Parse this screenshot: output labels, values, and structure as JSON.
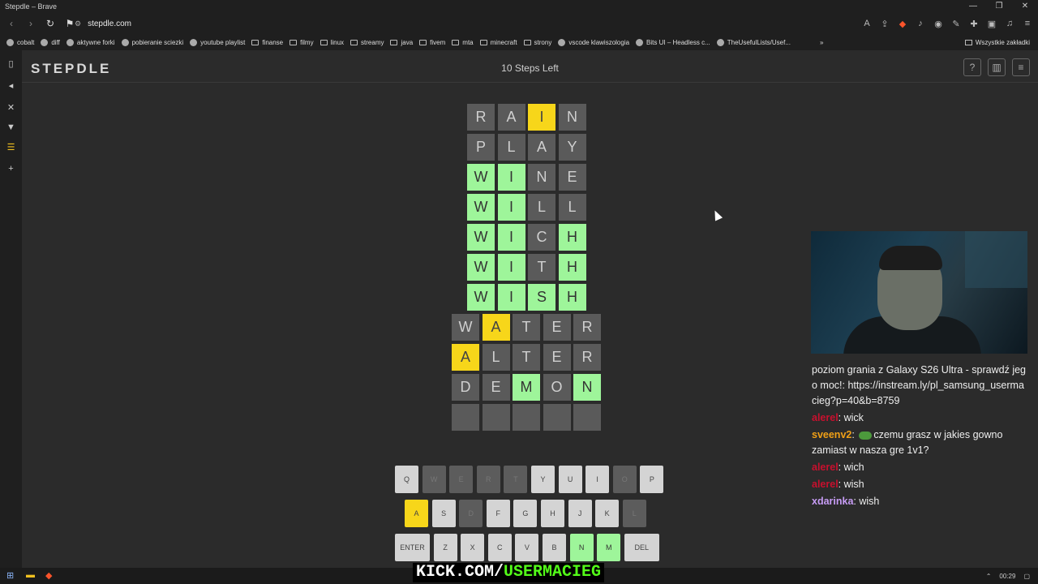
{
  "window": {
    "title": "Stepdle – Brave",
    "controls": [
      "—",
      "❐",
      "✕"
    ]
  },
  "browser": {
    "url": "stepdle.com",
    "bookmarks": [
      {
        "label": "cobalt",
        "icon": "cobalt-icon"
      },
      {
        "label": "diff",
        "icon": "diff-icon"
      },
      {
        "label": "aktywne forki",
        "icon": "fork-icon"
      },
      {
        "label": "pobieranie sciezki",
        "icon": "download-icon"
      },
      {
        "label": "youtube playlist",
        "icon": "globe-icon"
      },
      {
        "label": "finanse",
        "icon": "folder-icon"
      },
      {
        "label": "filmy",
        "icon": "folder-icon"
      },
      {
        "label": "linux",
        "icon": "folder-icon"
      },
      {
        "label": "streamy",
        "icon": "folder-icon"
      },
      {
        "label": "java",
        "icon": "folder-icon"
      },
      {
        "label": "fivem",
        "icon": "folder-icon"
      },
      {
        "label": "mta",
        "icon": "folder-icon"
      },
      {
        "label": "minecraft",
        "icon": "folder-icon"
      },
      {
        "label": "strony",
        "icon": "folder-icon"
      },
      {
        "label": "vscode klawiszologia",
        "icon": "vscode-icon"
      },
      {
        "label": "Bits UI – Headless c...",
        "icon": "bits-icon"
      },
      {
        "label": "TheUsefulLists/Usef...",
        "icon": "github-icon"
      }
    ],
    "bookmarks_more": "»",
    "all_bookmarks": "Wszystkie zakładki"
  },
  "app": {
    "logo": "STEPDLE",
    "steps_left": "10 Steps Left",
    "help": "?",
    "stats": "▥",
    "menu": "≡"
  },
  "board": [
    {
      "cols": 4,
      "tiles": [
        [
          "R",
          ""
        ],
        [
          "A",
          ""
        ],
        [
          "I",
          "y"
        ],
        [
          "N",
          ""
        ]
      ]
    },
    {
      "cols": 4,
      "tiles": [
        [
          "P",
          ""
        ],
        [
          "L",
          ""
        ],
        [
          "A",
          ""
        ],
        [
          "Y",
          ""
        ]
      ]
    },
    {
      "cols": 4,
      "tiles": [
        [
          "W",
          "g"
        ],
        [
          "I",
          "g"
        ],
        [
          "N",
          ""
        ],
        [
          "E",
          ""
        ]
      ]
    },
    {
      "cols": 4,
      "tiles": [
        [
          "W",
          "g"
        ],
        [
          "I",
          "g"
        ],
        [
          "L",
          ""
        ],
        [
          "L",
          ""
        ]
      ]
    },
    {
      "cols": 4,
      "tiles": [
        [
          "W",
          "g"
        ],
        [
          "I",
          "g"
        ],
        [
          "C",
          ""
        ],
        [
          "H",
          "g"
        ]
      ]
    },
    {
      "cols": 4,
      "tiles": [
        [
          "W",
          "g"
        ],
        [
          "I",
          "g"
        ],
        [
          "T",
          ""
        ],
        [
          "H",
          "g"
        ]
      ]
    },
    {
      "cols": 4,
      "tiles": [
        [
          "W",
          "g"
        ],
        [
          "I",
          "g"
        ],
        [
          "S",
          "g"
        ],
        [
          "H",
          "g"
        ]
      ]
    },
    {
      "cols": 5,
      "tiles": [
        [
          "W",
          ""
        ],
        [
          "A",
          "y"
        ],
        [
          "T",
          ""
        ],
        [
          "E",
          ""
        ],
        [
          "R",
          ""
        ]
      ]
    },
    {
      "cols": 5,
      "tiles": [
        [
          "A",
          "y"
        ],
        [
          "L",
          ""
        ],
        [
          "T",
          ""
        ],
        [
          "E",
          ""
        ],
        [
          "R",
          ""
        ]
      ]
    },
    {
      "cols": 5,
      "tiles": [
        [
          "D",
          ""
        ],
        [
          "E",
          ""
        ],
        [
          "M",
          "g"
        ],
        [
          "O",
          ""
        ],
        [
          "N",
          "g"
        ]
      ]
    },
    {
      "cols": 5,
      "tiles": [
        [
          "",
          "e"
        ],
        [
          "",
          "e"
        ],
        [
          "",
          "e"
        ],
        [
          "",
          "e"
        ],
        [
          "",
          "e"
        ]
      ]
    }
  ],
  "keyboard": [
    [
      [
        "Q",
        ""
      ],
      [
        "W",
        "d"
      ],
      [
        "E",
        "d"
      ],
      [
        "R",
        "d"
      ],
      [
        "T",
        "d"
      ],
      [
        "Y",
        ""
      ],
      [
        "U",
        ""
      ],
      [
        "I",
        ""
      ],
      [
        "O",
        "d"
      ],
      [
        "P",
        ""
      ]
    ],
    [
      [
        "A",
        "y"
      ],
      [
        "S",
        ""
      ],
      [
        "D",
        "d"
      ],
      [
        "F",
        ""
      ],
      [
        "G",
        ""
      ],
      [
        "H",
        ""
      ],
      [
        "J",
        ""
      ],
      [
        "K",
        ""
      ],
      [
        "L",
        "d"
      ]
    ],
    [
      [
        "ENTER",
        ""
      ],
      [
        "Z",
        ""
      ],
      [
        "X",
        ""
      ],
      [
        "C",
        ""
      ],
      [
        "V",
        ""
      ],
      [
        "B",
        ""
      ],
      [
        "N",
        "g"
      ],
      [
        "M",
        "g"
      ],
      [
        "DEL",
        ""
      ]
    ]
  ],
  "chat": {
    "system": "poziom grania z Galaxy S26 Ultra - sprawdź jego moc!: https://instream.ly/pl_samsung_usermacieg?p=40&b=8759",
    "messages": [
      {
        "user": "alerel",
        "cls": "u1",
        "text": "wick",
        "emote": false
      },
      {
        "user": "sveenv2",
        "cls": "u2",
        "text": "czemu grasz w jakies gowno zamiast w nasza gre 1v1?",
        "emote": true
      },
      {
        "user": "alerel",
        "cls": "u1",
        "text": "wich",
        "emote": false
      },
      {
        "user": "alerel",
        "cls": "u1",
        "text": "wish",
        "emote": false
      },
      {
        "user": "xdarinka",
        "cls": "u3",
        "text": "wish",
        "emote": false
      }
    ]
  },
  "overlay": {
    "kick_prefix": "KICK.COM/",
    "kick_user": "USERMACIEG"
  },
  "taskbar": {
    "time": "00:29"
  },
  "colors": {
    "yellow": "#f7d61a",
    "green": "#9ef59a",
    "gray": "#5a5a5a"
  }
}
